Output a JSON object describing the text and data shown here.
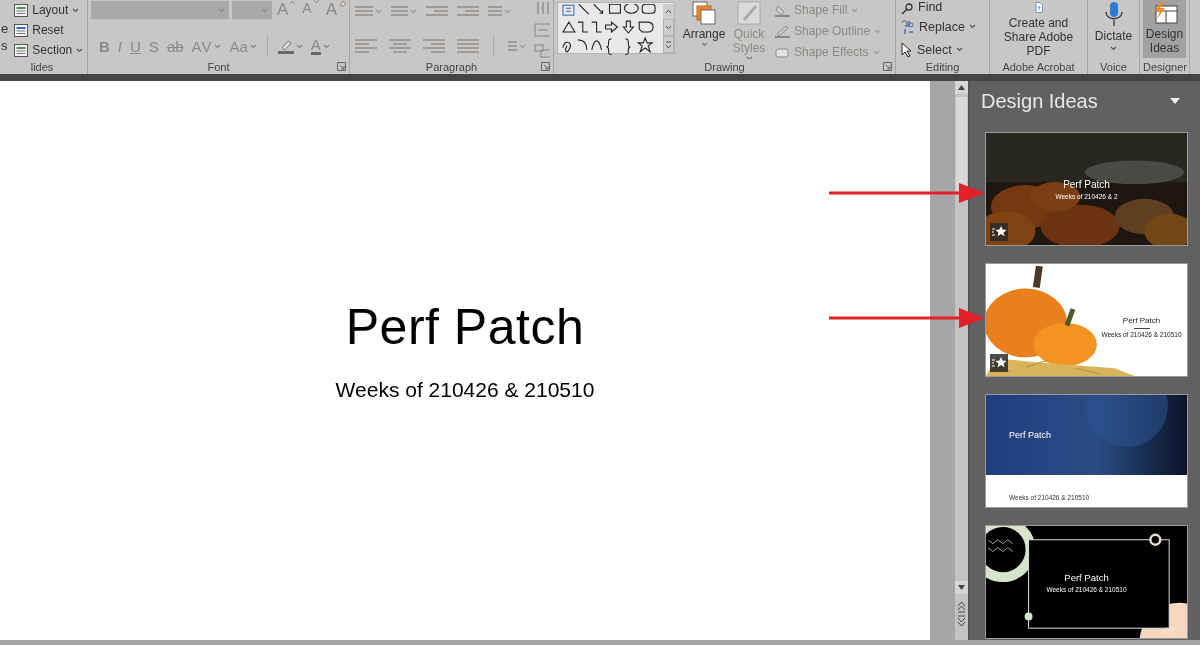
{
  "ribbon": {
    "groups": [
      {
        "kind": "slides",
        "label": "lides",
        "fragments": [
          "e",
          "s"
        ],
        "items": [
          {
            "label": "Layout",
            "caret": true
          },
          {
            "label": "Reset",
            "caret": false
          },
          {
            "label": "Section",
            "caret": true
          }
        ]
      },
      {
        "kind": "font",
        "label": "Font",
        "disabled": true,
        "top_buttons": [
          {
            "label": "A",
            "kind": "grow"
          },
          {
            "label": "A",
            "kind": "shrink"
          },
          {
            "label": "A",
            "kind": "clear"
          }
        ],
        "format_buttons": [
          {
            "label": "B"
          },
          {
            "label": "I"
          },
          {
            "label": "U"
          },
          {
            "label": "S"
          },
          {
            "label": "ab"
          },
          {
            "label": "AV"
          },
          {
            "label": "Aa"
          }
        ],
        "color_button": {
          "label": "A"
        }
      },
      {
        "kind": "paragraph",
        "label": "Paragraph",
        "disabled": true
      },
      {
        "kind": "drawing",
        "label": "Drawing",
        "big_buttons": [
          {
            "label": "Arrange",
            "disabled": false
          },
          {
            "label": "Quick Styles",
            "disabled": true
          }
        ],
        "shape_buttons": [
          {
            "label": "Shape Fill",
            "disabled": true
          },
          {
            "label": "Shape Outline",
            "disabled": true
          },
          {
            "label": "Shape Effects",
            "disabled": true
          }
        ]
      },
      {
        "kind": "editing",
        "label": "Editing",
        "buttons": [
          {
            "label": "Find",
            "caret": false
          },
          {
            "label": "Replace",
            "caret": true
          },
          {
            "label": "Select",
            "caret": true
          }
        ]
      },
      {
        "kind": "big",
        "label": "Adobe Acrobat",
        "button": {
          "label": "Create and Share Adobe PDF",
          "caret": false,
          "selected": false
        }
      },
      {
        "kind": "big",
        "label": "Voice",
        "button": {
          "label": "Dictate",
          "caret": true,
          "selected": false
        }
      },
      {
        "kind": "big",
        "label": "Designer",
        "button": {
          "label": "Design Ideas",
          "caret": false,
          "selected": true
        }
      }
    ]
  },
  "slide": {
    "title": "Perf Patch",
    "subtitle": "Weeks of 210426 & 210510"
  },
  "design_panel": {
    "title": "Design Ideas",
    "designs": [
      {
        "kind": "photo-dark",
        "title": "Perf Patch",
        "subtitle": "Weeks of 210426 & 2",
        "starred": true,
        "pointed": true
      },
      {
        "kind": "photo-white",
        "title": "Perf Patch",
        "subtitle": "Weeks of 210426 & 210510",
        "starred": true,
        "pointed": true
      },
      {
        "kind": "blue",
        "title": "Perf Patch",
        "subtitle": "Weeks of 210426 & 210510",
        "starred": false,
        "pointed": false
      },
      {
        "kind": "black",
        "title": "Perf Patch",
        "subtitle": "Weeks of 210426 & 210510",
        "starred": false,
        "pointed": false
      }
    ]
  }
}
